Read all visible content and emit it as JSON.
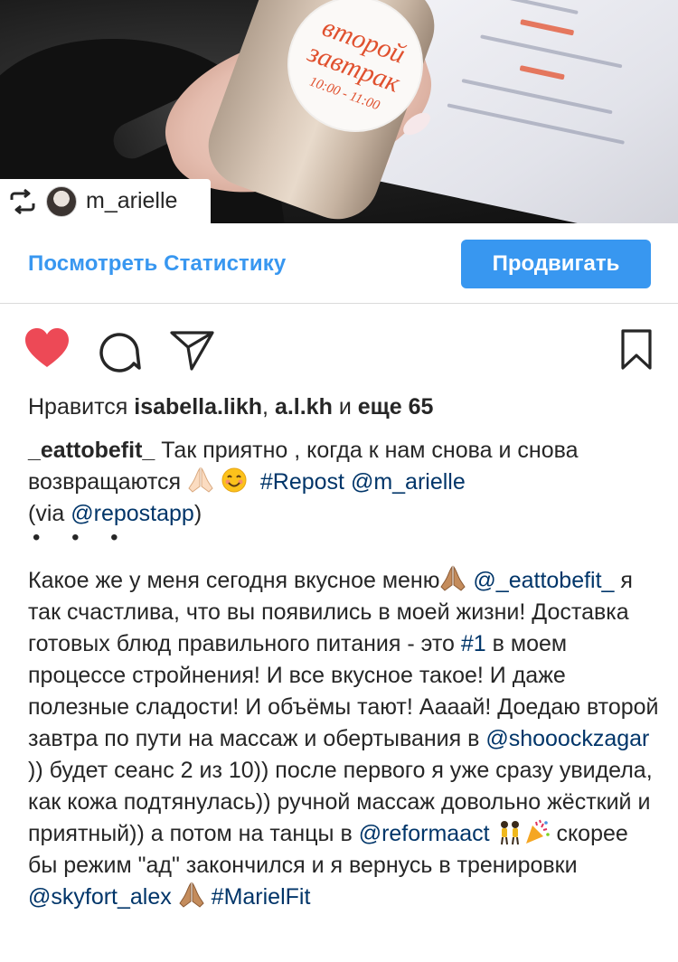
{
  "photo": {
    "label_line1": "второй",
    "label_line2": "завтрак",
    "label_time": "10:00 - 11:00"
  },
  "repost": {
    "username": "m_arielle"
  },
  "stats": {
    "view_insights": "Посмотреть Статистику",
    "promote": "Продвигать"
  },
  "likes": {
    "prefix": "Нравится",
    "user1": "isabella.likh",
    "separator": ",",
    "user2": "a.l.kh",
    "and": "и",
    "more": "еще 65"
  },
  "caption": {
    "username": "_eattobefit_",
    "text": "Так приятно , когда к нам снова и снова возвращаются",
    "hashtag_repost": "#Repost",
    "mention_arielle": "@m_arielle",
    "via_prefix": "(via",
    "mention_repostapp": "@repostapp",
    "via_suffix": ")",
    "dots": "• • •"
  },
  "body": {
    "t1": "Какое же у меня сегодня вкусное меню",
    "m1": "@_eattobefit_",
    "t2": "я так счастлива, что вы появились в моей жизни! Доставка готовых блюд правильного питания - это",
    "h1": "#1",
    "t3": "в моем процессе стройнения! И все вкусное такое! И даже полезные сладости! И объёмы тают! Аааай! Доедаю второй завтра по пути на массаж и обертывания в",
    "m2": "@shooockzagar",
    "t4": ")) будет сеанс 2 из 10)) после первого я уже сразу увидела, как кожа подтянулась)) ручной массаж довольно жёсткий и приятный)) а потом на танцы в",
    "m3": "@reformaact",
    "t5": "скорее бы режим \"ад\" закончился и я вернусь в тренировки",
    "m4": "@skyfort_alex",
    "h2": "#MarielFit"
  },
  "colors": {
    "link_blue": "#3897f0",
    "tag_blue": "#003569",
    "heart_red": "#ed4956",
    "text": "#262626"
  }
}
